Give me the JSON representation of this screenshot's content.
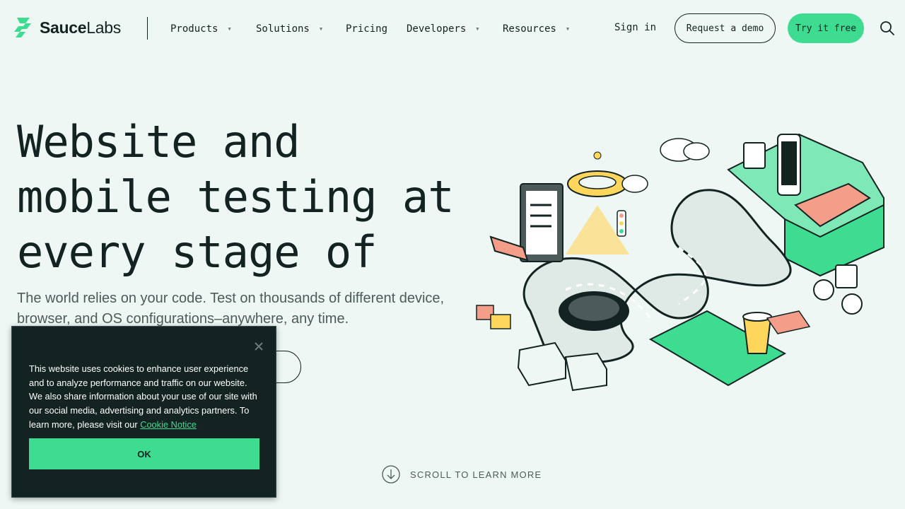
{
  "brand": {
    "name_bold": "Sauce",
    "name_light": "Labs",
    "accent": "#3ddc91",
    "dark": "#132322",
    "background": "#eef7f4"
  },
  "nav": {
    "items": [
      {
        "label": "Products",
        "has_dropdown": true
      },
      {
        "label": "Solutions",
        "has_dropdown": true
      },
      {
        "label": "Pricing",
        "has_dropdown": false
      },
      {
        "label": "Developers",
        "has_dropdown": true
      },
      {
        "label": "Resources",
        "has_dropdown": true
      }
    ],
    "dropdown_icon": "triangle-down-icon"
  },
  "header": {
    "sign_in": "Sign in",
    "request_demo": "Request a demo",
    "try_free": "Try it free",
    "search_icon": "search-icon"
  },
  "hero": {
    "title_lines": [
      "Website and",
      "mobile testing at",
      "every stage of"
    ],
    "subtitle": "The world relies on your code. Test on thousands of different device, browser, and OS configurations–anywhere, any time.",
    "illustration": "infinity-road-illustration"
  },
  "scroll": {
    "label": "SCROLL TO LEARN MORE",
    "icon": "arrow-down-circle-icon"
  },
  "cookie": {
    "text": "This website uses cookies to enhance user experience and to analyze performance and traffic on our website. We also share information about your use of our site with our social media, advertising and analytics partners. To learn more, please visit our",
    "link": "Cookie Notice",
    "ok": "OK",
    "close_icon": "close-icon"
  }
}
